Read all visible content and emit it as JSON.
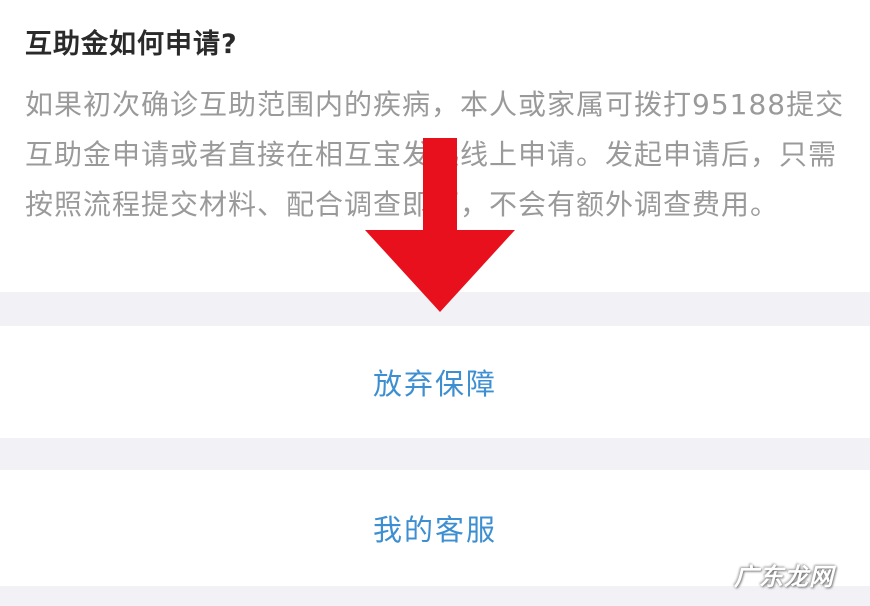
{
  "faq": {
    "title": "互助金如何申请?",
    "body": "如果初次确诊互助范围内的疾病，本人或家属可拨打95188提交互助金申请或者直接在相互宝发起线上申请。发起申请后，只需按照流程提交材料、配合调查即可，不会有额外调查费用。"
  },
  "actions": {
    "abandon_label": "放弃保障",
    "service_label": "我的客服"
  },
  "watermark": {
    "text": "广东龙网"
  },
  "colors": {
    "page_background": "#f2f1f5",
    "card_background": "#ffffff",
    "title_text": "#2a2a2a",
    "body_text": "#9a9a9a",
    "action_text": "#3d8fd1",
    "arrow": "#e8101c"
  },
  "icons": {
    "arrow": "red-down-arrow-icon"
  }
}
